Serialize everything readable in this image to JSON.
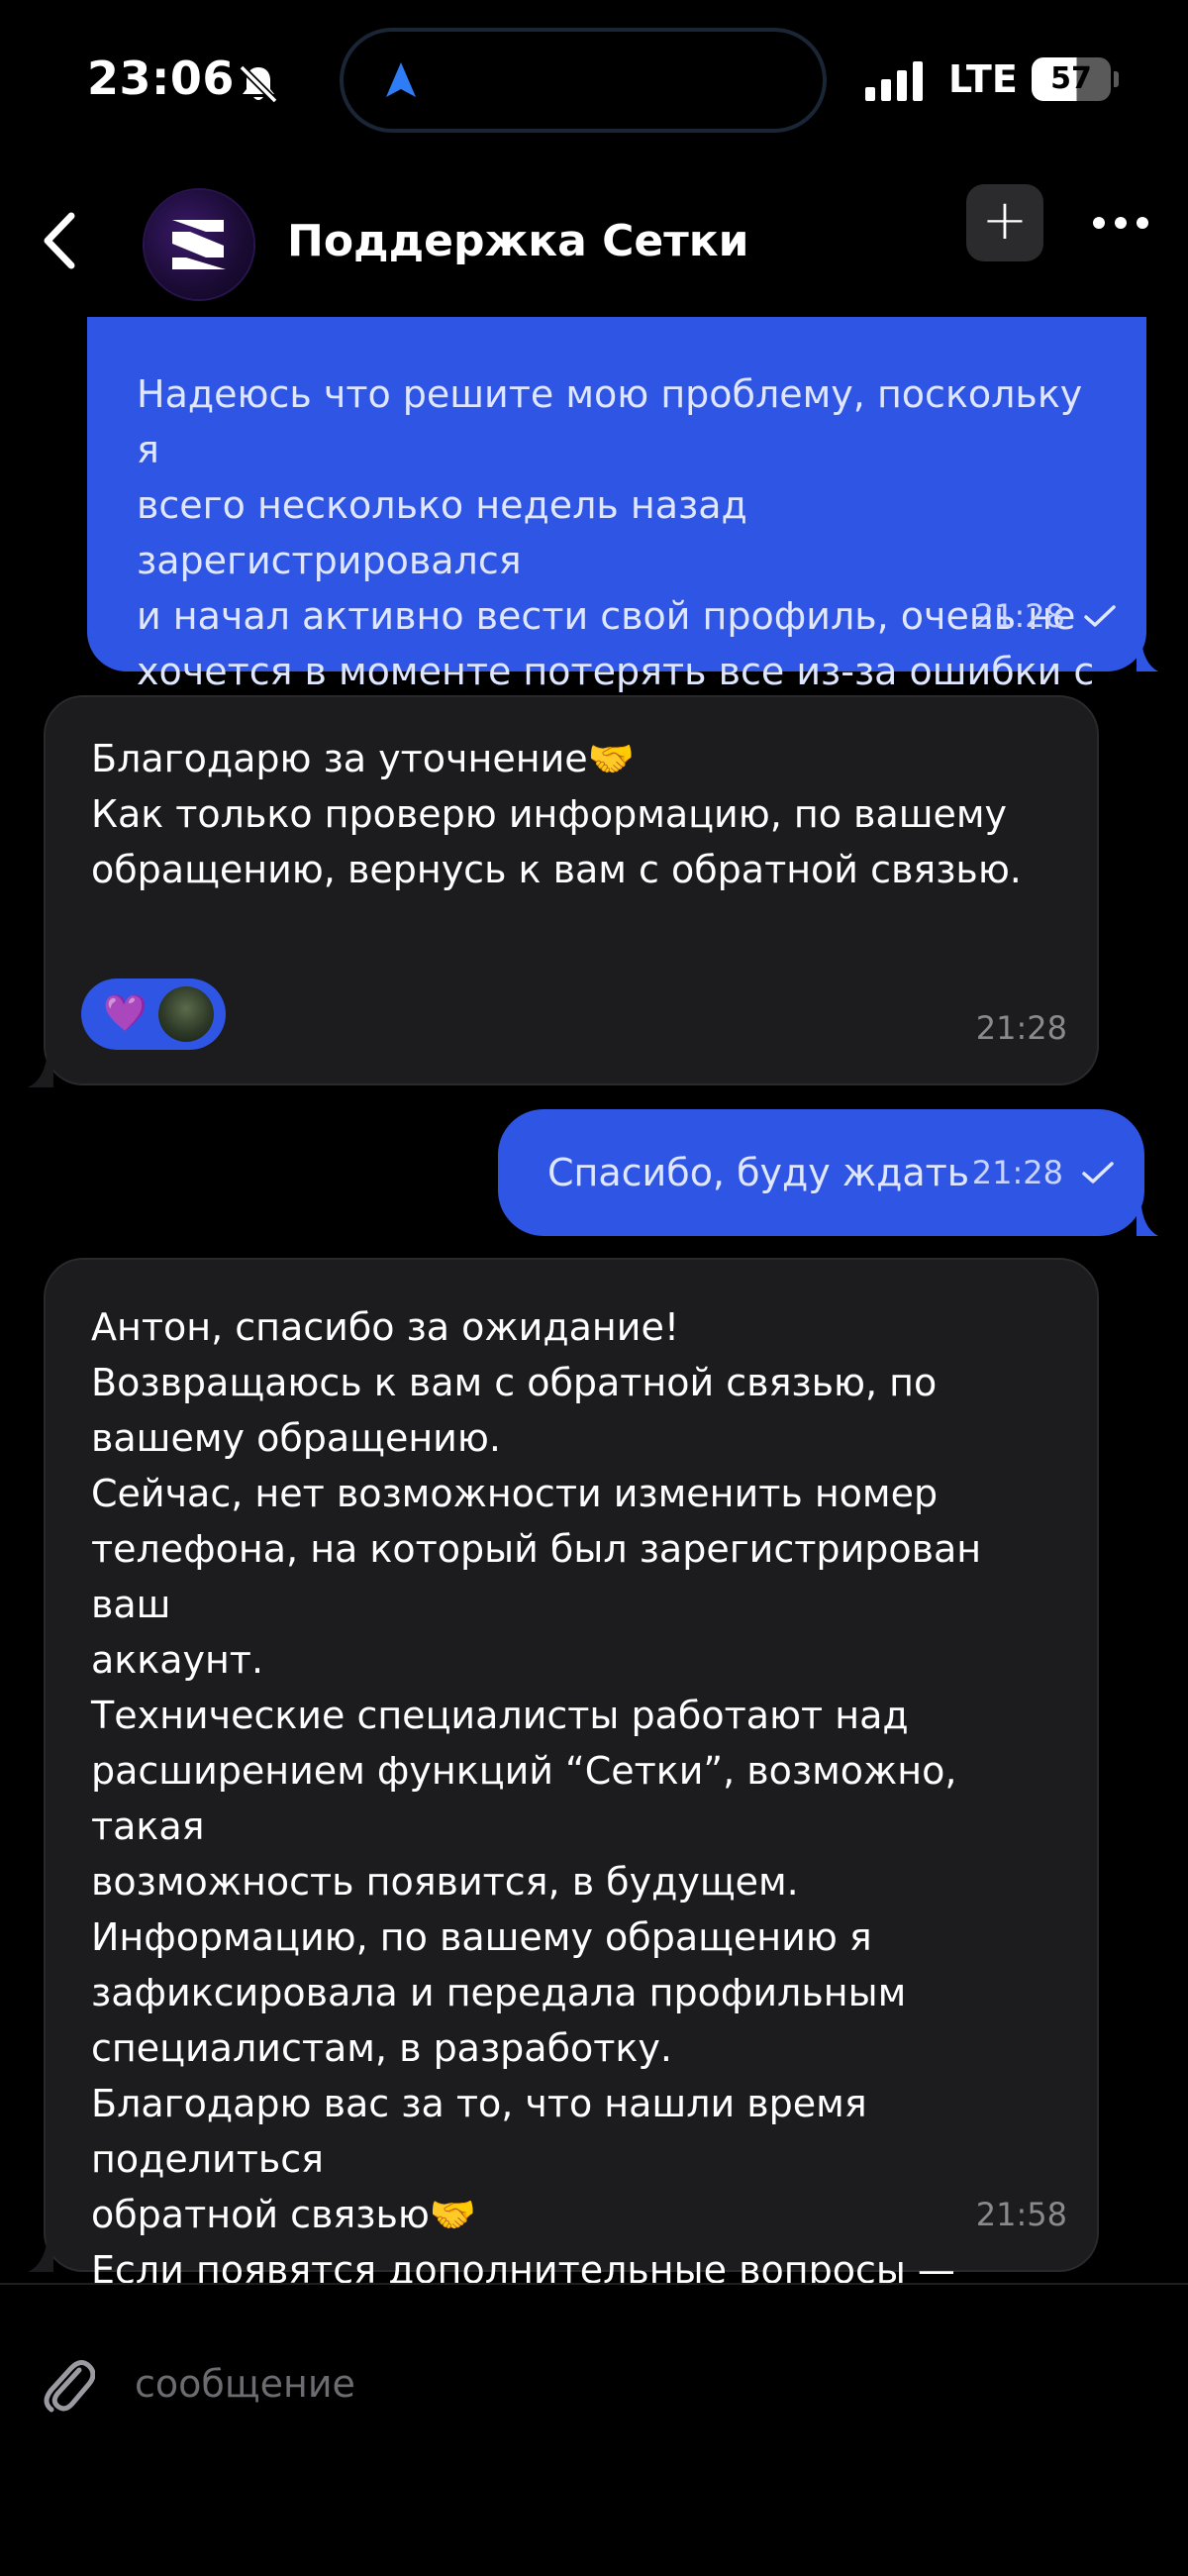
{
  "status_bar": {
    "time": "23:06",
    "network": "LTE",
    "battery": "57",
    "battery_level": 0.57
  },
  "header": {
    "title": "Поддержка Сетки",
    "add_label": "+"
  },
  "messages": [
    {
      "direction": "outgoing",
      "text": "Надеюсь что решите мою проблему, поскольку я\nвсего несколько недель назад зарегистрировался\nи начал активно вести свой профиль, очень не\nхочется в моменте потерять все из-за ошибки с\nрегистрацией на другой номер",
      "time": "21:28"
    },
    {
      "direction": "incoming",
      "text": "Благодарю за уточнение🤝\nКак только проверю информацию, по вашему\nобращению, вернусь к вам с обратной связью.",
      "time": "21:28",
      "reaction": "💜"
    },
    {
      "direction": "outgoing",
      "text": "Спасибо, буду ждать",
      "time": "21:28"
    },
    {
      "direction": "incoming",
      "text": "Антон, спасибо за ожидание!\nВозвращаюсь к вам с обратной связью, по\nвашему обращению.\nСейчас, нет возможности изменить номер\nтелефона, на который был зарегистрирован ваш\nаккаунт.\nТехнические специалисты работают над\nрасширением функций “Сетки”, возможно, такая\nвозможность появится, в будущем.\nИнформацию, по вашему обращению я\nзафиксировала и передала профильным\nспециалистам, в разработку.\nБлагодарю вас за то, что нашли время поделиться\nобратной связью🤝\nЕсли появятся дополнительные вопросы —\nпожалуйста, напишите нам🌟\nВсего доброго!",
      "time": "21:58"
    }
  ],
  "composer": {
    "placeholder": "сообщение"
  },
  "colors": {
    "outgoing_bubble": "#2f55e4",
    "incoming_bubble": "#1c1c1e",
    "background": "#000000"
  }
}
